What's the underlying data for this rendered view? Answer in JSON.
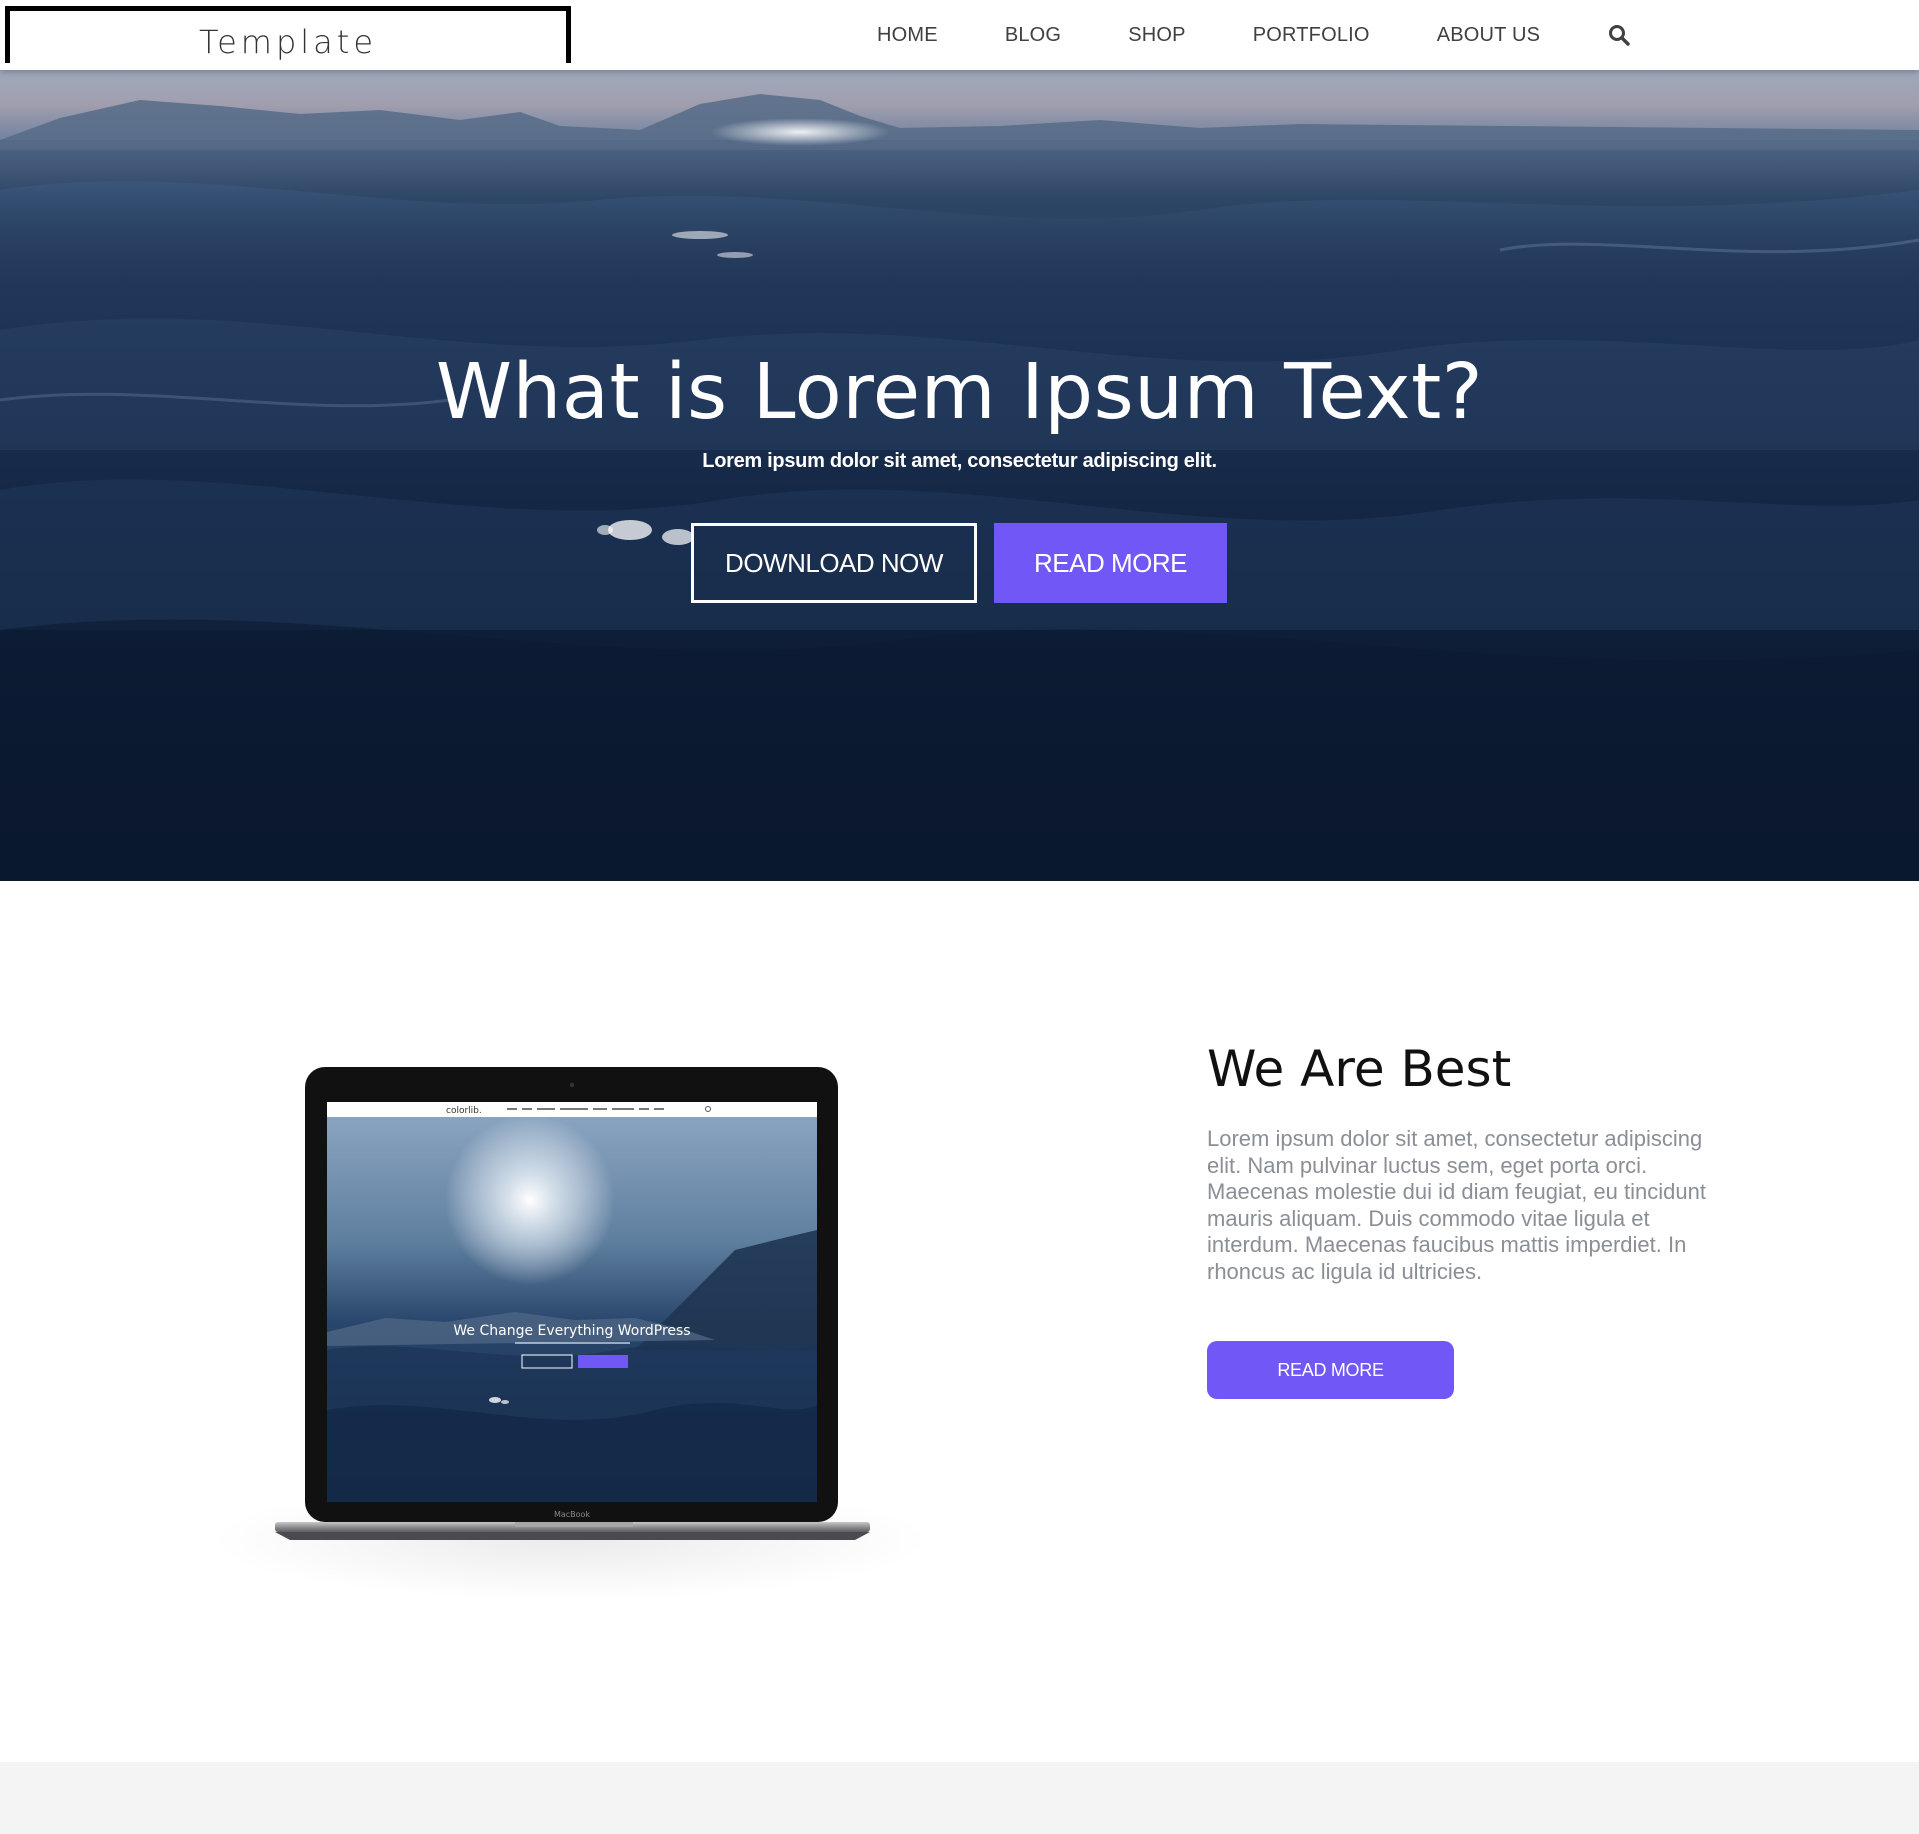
{
  "header": {
    "logo": "Template",
    "nav": [
      {
        "label": "HOME"
      },
      {
        "label": "BLOG"
      },
      {
        "label": "SHOP"
      },
      {
        "label": "PORTFOLIO"
      },
      {
        "label": "ABOUT US"
      }
    ],
    "search_icon": "search-icon"
  },
  "hero": {
    "title": "What is Lorem Ipsum Text?",
    "subtitle": "Lorem ipsum dolor sit amet, consectetur adipiscing elit.",
    "download_label": "DOWNLOAD NOW",
    "readmore_label": "READ MORE"
  },
  "laptop": {
    "brand": "colorlib.",
    "screen_title": "We Change Everything WordPress",
    "device_label": "MacBook"
  },
  "about": {
    "title": "We Are Best",
    "text": "Lorem ipsum dolor sit amet, consectetur adipiscing elit. Nam pulvinar luctus sem, eget porta orci. Maecenas molestie dui id diam feugiat, eu tincidunt mauris aliquam. Duis commodo vitae ligula et interdum. Maecenas faucibus mattis imperdiet. In rhoncus ac ligula id ultricies.",
    "button_label": "READ MORE"
  },
  "colors": {
    "accent": "#7157f5",
    "hero_dark": "#0b1830",
    "text_grey": "#8a8f96"
  }
}
